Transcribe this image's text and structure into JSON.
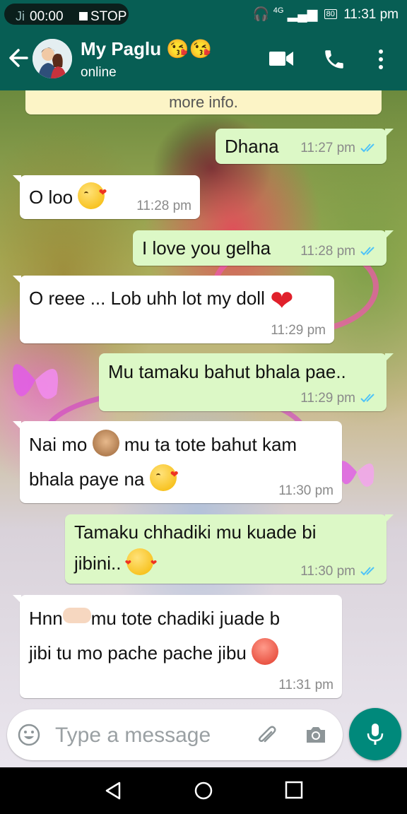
{
  "status_bar": {
    "rec_prefix": "Ji",
    "rec_time": "00:00",
    "stop_label": "STOP",
    "network": "4G",
    "battery": "80",
    "clock": "11:31 pm"
  },
  "header": {
    "contact_name": "My Paglu 😘😘",
    "contact_status": "online",
    "accent_color": "#075e54"
  },
  "chat": {
    "info_banner": "more info.",
    "messages": [
      {
        "dir": "out",
        "text": "Dhana",
        "time": "11:27 pm",
        "read": true
      },
      {
        "dir": "in",
        "text": "O loo",
        "time": "11:28 pm"
      },
      {
        "dir": "out",
        "text": "I love you gelha",
        "time": "11:28 pm",
        "read": true
      },
      {
        "dir": "in",
        "text": "O reee ... Lob uhh lot my doll",
        "time": "11:29 pm"
      },
      {
        "dir": "out",
        "text": "Mu tamaku bahut bhala pae..",
        "time": "11:29 pm",
        "read": true
      },
      {
        "dir": "in",
        "line1a": "Nai mo",
        "line1b": "mu ta tote bahut kam",
        "line2": "bhala paye na",
        "time": "11:30 pm"
      },
      {
        "dir": "out",
        "line1": "Tamaku chhadiki mu kuade bi",
        "line2": "jibini..",
        "time": "11:30 pm",
        "read": true
      },
      {
        "dir": "in",
        "line1a": "Hnn",
        "line1b": "mu tote chadiki juade b",
        "line2": "jibi tu mo pache pache jibu",
        "time": "11:31 pm"
      }
    ]
  },
  "composer": {
    "placeholder": "Type a message",
    "emoji_icon": "emoji-icon",
    "attach_icon": "paperclip-icon",
    "camera_icon": "camera-icon",
    "mic_icon": "mic-icon"
  },
  "nav": {
    "back_icon": "triangle-back-icon",
    "home_icon": "circle-home-icon",
    "recents_icon": "square-recents-icon"
  },
  "colors": {
    "outgoing_bubble": "#dcf8c6",
    "incoming_bubble": "#ffffff",
    "read_ticks": "#4fc3f7"
  }
}
